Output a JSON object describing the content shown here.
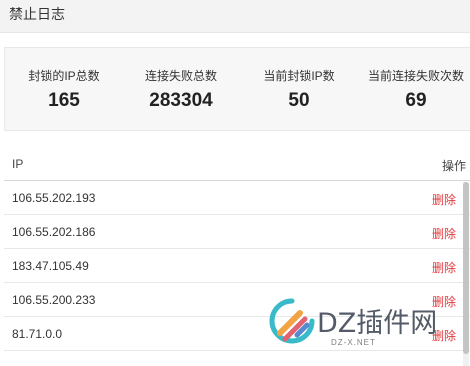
{
  "dialog": {
    "title": "禁止日志"
  },
  "stats": [
    {
      "label": "封锁的IP总数",
      "value": "165"
    },
    {
      "label": "连接失败总数",
      "value": "283304"
    },
    {
      "label": "当前封锁IP数",
      "value": "50"
    },
    {
      "label": "当前连接失败次数",
      "value": "69"
    }
  ],
  "table": {
    "headers": {
      "ip": "IP",
      "action": "操作"
    },
    "rows": [
      {
        "ip": "106.55.202.193",
        "action": "删除"
      },
      {
        "ip": "106.55.202.186",
        "action": "删除"
      },
      {
        "ip": "183.47.105.49",
        "action": "删除"
      },
      {
        "ip": "106.55.200.233",
        "action": "删除"
      },
      {
        "ip": "81.71.0.0",
        "action": "删除"
      }
    ]
  },
  "watermark": {
    "brand": "DZ插件网",
    "url": "DZ-X.NET"
  },
  "colors": {
    "delete": "#e0393e",
    "header_bg": "#f3f3f3",
    "stats_bg": "#f7f7f7"
  }
}
